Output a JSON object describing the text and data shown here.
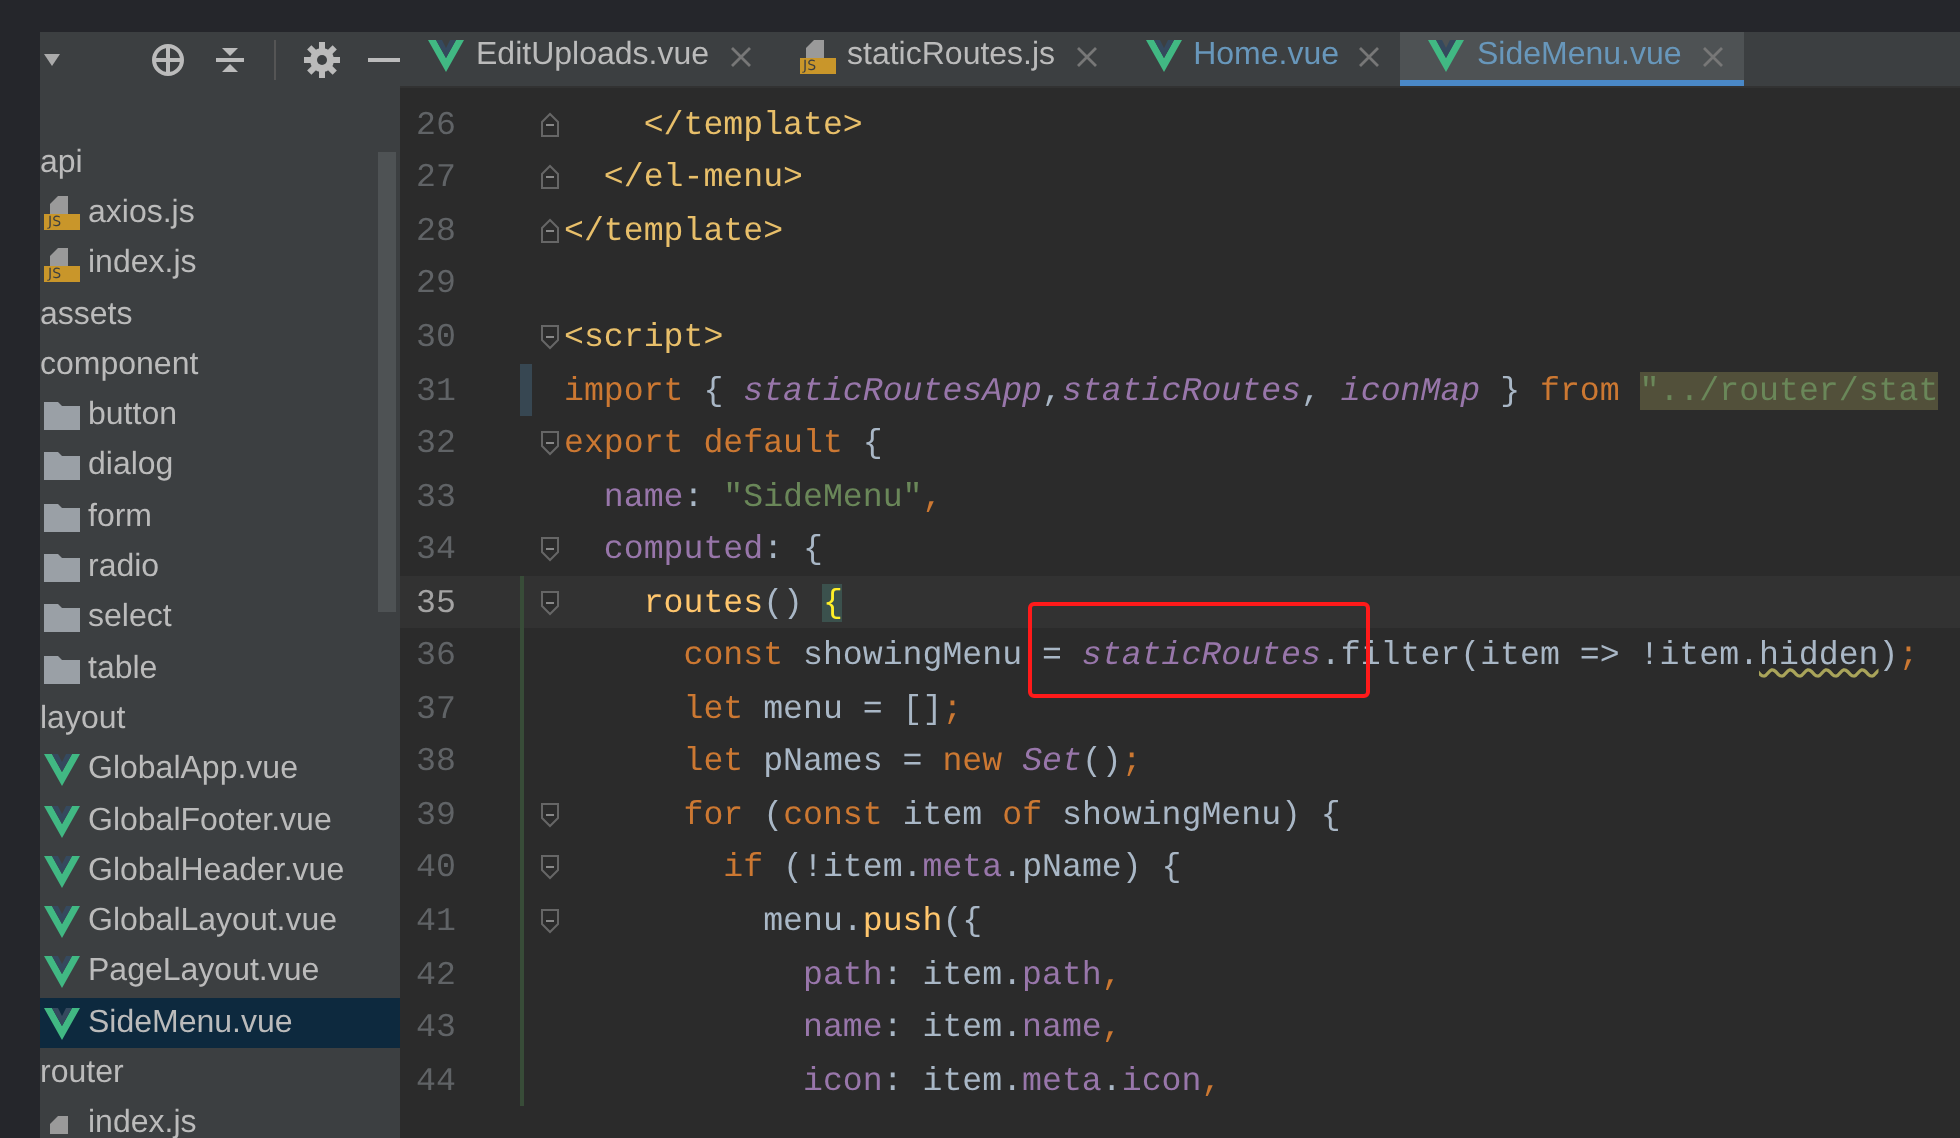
{
  "project_tree": [
    {
      "label": "api",
      "kind": "dir",
      "selected": false,
      "children": [
        {
          "label": "axios.js",
          "kind": "js",
          "badge": "JS",
          "selected": false
        },
        {
          "label": "index.js",
          "kind": "js",
          "badge": "JS",
          "selected": false
        }
      ]
    },
    {
      "label": "assets",
      "kind": "dir",
      "selected": false
    },
    {
      "label": "component",
      "kind": "dir",
      "selected": false,
      "children": [
        {
          "label": "button",
          "kind": "folder",
          "selected": false
        },
        {
          "label": "dialog",
          "kind": "folder",
          "selected": false
        },
        {
          "label": "form",
          "kind": "folder",
          "selected": false
        },
        {
          "label": "radio",
          "kind": "folder",
          "selected": false
        },
        {
          "label": "select",
          "kind": "folder",
          "selected": false
        },
        {
          "label": "table",
          "kind": "folder",
          "selected": false
        }
      ]
    },
    {
      "label": "layout",
      "kind": "dir",
      "selected": false,
      "children": [
        {
          "label": "GlobalApp.vue",
          "kind": "vue",
          "selected": false
        },
        {
          "label": "GlobalFooter.vue",
          "kind": "vue",
          "selected": false
        },
        {
          "label": "GlobalHeader.vue",
          "kind": "vue",
          "selected": false
        },
        {
          "label": "GlobalLayout.vue",
          "kind": "vue",
          "selected": false
        },
        {
          "label": "PageLayout.vue",
          "kind": "vue",
          "selected": false
        },
        {
          "label": "SideMenu.vue",
          "kind": "vue",
          "selected": true
        }
      ]
    },
    {
      "label": "router",
      "kind": "dir",
      "selected": false,
      "children": [
        {
          "label": "index.js",
          "kind": "js",
          "selected": false
        }
      ]
    }
  ],
  "tabs": [
    {
      "label": "EditUploads.vue",
      "kind": "vue",
      "modified": false,
      "selected": false
    },
    {
      "label": "staticRoutes.js",
      "kind": "js",
      "badge": "JS",
      "modified": false,
      "selected": false
    },
    {
      "label": "Home.vue",
      "kind": "vue",
      "modified": true,
      "selected": false
    },
    {
      "label": "SideMenu.vue",
      "kind": "vue",
      "modified": true,
      "selected": true
    }
  ],
  "editor": {
    "lines": [
      {
        "number": "26",
        "fold_open": false,
        "fold_close": true,
        "current": false,
        "modified": false,
        "added": false,
        "tokens": [
          {
            "kind": "tag",
            "text": "    </template>"
          }
        ]
      },
      {
        "number": "27",
        "fold_open": false,
        "fold_close": true,
        "current": false,
        "modified": false,
        "added": false,
        "tokens": [
          {
            "kind": "tag",
            "text": "  </el-menu>"
          }
        ]
      },
      {
        "number": "28",
        "fold_open": false,
        "fold_close": true,
        "current": false,
        "modified": false,
        "added": false,
        "tokens": [
          {
            "kind": "tag",
            "text": "</template>"
          }
        ]
      },
      {
        "number": "29",
        "fold_open": false,
        "fold_close": false,
        "current": false,
        "modified": false,
        "added": false
      },
      {
        "number": "30",
        "fold_open": true,
        "fold_close": false,
        "current": false,
        "modified": false,
        "added": false,
        "tokens": [
          {
            "kind": "tag",
            "text": "<script>"
          }
        ]
      },
      {
        "number": "31",
        "fold_open": false,
        "fold_close": false,
        "current": false,
        "modified": true,
        "added": false,
        "tokens": [
          {
            "kind": "kw",
            "text": "import "
          },
          {
            "kind": "text",
            "text": "{ "
          },
          {
            "kind": "ivar",
            "text": "staticRoutesApp"
          },
          {
            "kind": "text",
            "text": ","
          },
          {
            "kind": "ivar",
            "text": "staticRoutes"
          },
          {
            "kind": "text",
            "text": ", "
          },
          {
            "kind": "ivar",
            "text": "iconMap"
          },
          {
            "kind": "text",
            "text": " } "
          },
          {
            "kind": "kw",
            "text": "from "
          },
          {
            "kind": "strbg",
            "text": "\"../router/stat"
          }
        ]
      },
      {
        "number": "32",
        "fold_open": true,
        "fold_close": false,
        "current": false,
        "modified": false,
        "added": false,
        "tokens": [
          {
            "kind": "kw",
            "text": "export default "
          },
          {
            "kind": "text",
            "text": "{"
          }
        ]
      },
      {
        "number": "33",
        "fold_open": false,
        "fold_close": false,
        "current": false,
        "modified": false,
        "added": false,
        "tokens": [
          {
            "kind": "prop",
            "text": "  name"
          },
          {
            "kind": "text",
            "text": ": "
          },
          {
            "kind": "str",
            "text": "\"SideMenu\""
          },
          {
            "kind": "kw",
            "text": ","
          }
        ]
      },
      {
        "number": "34",
        "fold_open": true,
        "fold_close": false,
        "current": false,
        "modified": false,
        "added": false,
        "tokens": [
          {
            "kind": "prop",
            "text": "  computed"
          },
          {
            "kind": "text",
            "text": ": {"
          }
        ]
      },
      {
        "number": "35",
        "fold_open": true,
        "fold_close": false,
        "current": true,
        "modified": false,
        "added": true,
        "tokens": [
          {
            "kind": "fn",
            "text": "    routes"
          },
          {
            "kind": "text",
            "text": "() "
          },
          {
            "kind": "brace",
            "text": "{"
          }
        ]
      },
      {
        "number": "36",
        "fold_open": false,
        "fold_close": false,
        "current": false,
        "modified": false,
        "added": true,
        "tokens": [
          {
            "kind": "kw",
            "text": "      const "
          },
          {
            "kind": "text",
            "text": "showingMenu = "
          },
          {
            "kind": "ivar",
            "text": "staticRoutes"
          },
          {
            "kind": "text",
            "text": ".filter(item => !item."
          },
          {
            "kind": "warn",
            "text": "hidden"
          },
          {
            "kind": "text",
            "text": ")"
          },
          {
            "kind": "kw",
            "text": ";"
          }
        ]
      },
      {
        "number": "37",
        "fold_open": false,
        "fold_close": false,
        "current": false,
        "modified": false,
        "added": true,
        "tokens": [
          {
            "kind": "kw",
            "text": "      let "
          },
          {
            "kind": "text",
            "text": "menu = []"
          },
          {
            "kind": "kw",
            "text": ";"
          }
        ]
      },
      {
        "number": "38",
        "fold_open": false,
        "fold_close": false,
        "current": false,
        "modified": false,
        "added": true,
        "tokens": [
          {
            "kind": "kw",
            "text": "      let "
          },
          {
            "kind": "text",
            "text": "pNames = "
          },
          {
            "kind": "kw",
            "text": "new "
          },
          {
            "kind": "ivar",
            "text": "Set"
          },
          {
            "kind": "text",
            "text": "()"
          },
          {
            "kind": "kw",
            "text": ";"
          }
        ]
      },
      {
        "number": "39",
        "fold_open": true,
        "fold_close": false,
        "current": false,
        "modified": false,
        "added": true,
        "tokens": [
          {
            "kind": "kw",
            "text": "      for "
          },
          {
            "kind": "text",
            "text": "("
          },
          {
            "kind": "kw",
            "text": "const "
          },
          {
            "kind": "text",
            "text": "item "
          },
          {
            "kind": "kw",
            "text": "of "
          },
          {
            "kind": "text",
            "text": "showingMenu) {"
          }
        ]
      },
      {
        "number": "40",
        "fold_open": true,
        "fold_close": false,
        "current": false,
        "modified": false,
        "added": true,
        "tokens": [
          {
            "kind": "kw",
            "text": "        if "
          },
          {
            "kind": "text",
            "text": "(!item."
          },
          {
            "kind": "prop",
            "text": "meta"
          },
          {
            "kind": "text",
            "text": ".pName) {"
          }
        ]
      },
      {
        "number": "41",
        "fold_open": true,
        "fold_close": false,
        "current": false,
        "modified": false,
        "added": true,
        "tokens": [
          {
            "kind": "text",
            "text": "          menu."
          },
          {
            "kind": "fn",
            "text": "push"
          },
          {
            "kind": "text",
            "text": "({"
          }
        ]
      },
      {
        "number": "42",
        "fold_open": false,
        "fold_close": false,
        "current": false,
        "modified": false,
        "added": true,
        "tokens": [
          {
            "kind": "prop",
            "text": "            path"
          },
          {
            "kind": "text",
            "text": ": item."
          },
          {
            "kind": "prop",
            "text": "path"
          },
          {
            "kind": "kw",
            "text": ","
          }
        ]
      },
      {
        "number": "43",
        "fold_open": false,
        "fold_close": false,
        "current": false,
        "modified": false,
        "added": true,
        "tokens": [
          {
            "kind": "prop",
            "text": "            name"
          },
          {
            "kind": "text",
            "text": ": item."
          },
          {
            "kind": "prop",
            "text": "name"
          },
          {
            "kind": "kw",
            "text": ","
          }
        ]
      },
      {
        "number": "44",
        "fold_open": false,
        "fold_close": false,
        "current": false,
        "modified": false,
        "added": true,
        "tokens": [
          {
            "kind": "prop",
            "text": "            icon"
          },
          {
            "kind": "text",
            "text": ": item."
          },
          {
            "kind": "prop",
            "text": "meta"
          },
          {
            "kind": "text",
            "text": "."
          },
          {
            "kind": "prop",
            "text": "icon"
          },
          {
            "kind": "kw",
            "text": ","
          }
        ]
      }
    ]
  }
}
